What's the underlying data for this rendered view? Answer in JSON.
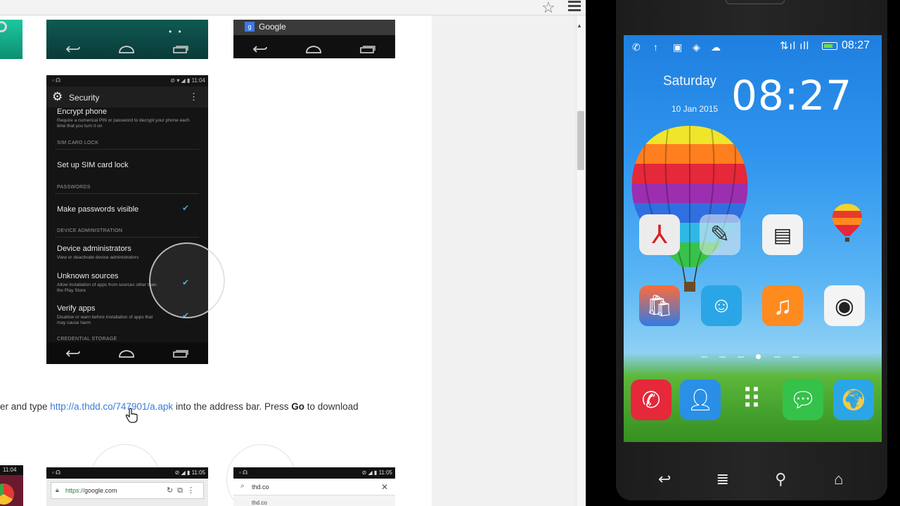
{
  "browser": {
    "star_icon": "star-outline-icon",
    "menu_icon": "hamburger-menu-icon",
    "instruction": {
      "before": "er and type ",
      "link": "http://a.thdd.co/747901/a.apk",
      "middle": " into the address bar. Press ",
      "bold": "Go",
      "after": " to download"
    },
    "shot_b_title": "Google",
    "security_screen": {
      "status_time": "11:04",
      "title": "Security",
      "encrypt_title": "Encrypt phone",
      "encrypt_sub": "Require a numerical PIN or password to decrypt your phone each time that you turn it on",
      "sim_header": "SIM CARD LOCK",
      "sim_item": "Set up SIM card lock",
      "passwords_header": "PASSWORDS",
      "passwords_item": "Make passwords visible",
      "devadmin_header": "DEVICE ADMINISTRATION",
      "devadmin_item": "Device administrators",
      "devadmin_sub": "View or deactivate device administrators",
      "unknown_item": "Unknown sources",
      "unknown_sub": "Allow installation of apps from sources other than the Play Store",
      "verify_item": "Verify apps",
      "verify_sub": "Disallow or warn before installation of apps that may cause harm",
      "credential_header": "CREDENTIAL STORAGE"
    },
    "shot_c": {
      "status_time": "11:05",
      "url": "google.com",
      "url_prefix": "https://"
    },
    "shot_d": {
      "status_time": "11:05",
      "query": "thd.co",
      "suggestion": "thd.co"
    },
    "shot_bl": {
      "status_time": "11:04"
    }
  },
  "phone": {
    "status_time": "08:27",
    "day": "Saturday",
    "date": "10 Jan 2015",
    "clock": "08:27",
    "apps": [
      {
        "name": "pdf-reader-app",
        "label": ""
      },
      {
        "name": "notes-app",
        "label": ""
      },
      {
        "name": "file-manager-app",
        "label": ""
      },
      {
        "name": "market-app",
        "label": ""
      },
      {
        "name": "messenger-app",
        "label": ""
      },
      {
        "name": "music-app",
        "label": ""
      },
      {
        "name": "camera-app",
        "label": ""
      }
    ],
    "dock": [
      {
        "name": "phone-app"
      },
      {
        "name": "contacts-app"
      },
      {
        "name": "app-drawer"
      },
      {
        "name": "messages-app"
      },
      {
        "name": "browser-app"
      }
    ],
    "nav": [
      "back-icon",
      "menu-icon",
      "search-icon",
      "home-icon"
    ],
    "colors": {
      "screen_top": "#1f7fe0",
      "grass": "#3d9a2a",
      "accent_check": "#3aa8d0"
    }
  }
}
